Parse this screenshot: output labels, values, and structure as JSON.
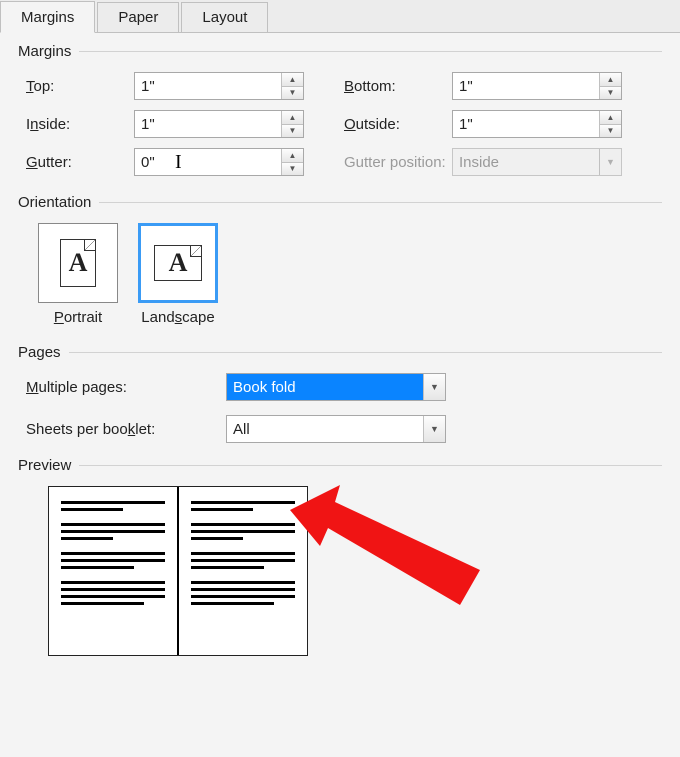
{
  "tabs": {
    "margins": "Margins",
    "paper": "Paper",
    "layout": "Layout"
  },
  "sections": {
    "margins": "Margins",
    "orientation": "Orientation",
    "pages": "Pages",
    "preview": "Preview"
  },
  "margins": {
    "top": {
      "label": "Top:",
      "value": "1\""
    },
    "bottom": {
      "label": "Bottom:",
      "value": "1\""
    },
    "inside": {
      "label": "Inside:",
      "value": "1\""
    },
    "outside": {
      "label": "Outside:",
      "value": "1\""
    },
    "gutter": {
      "label": "Gutter:",
      "value": "0\""
    },
    "gutter_pos": {
      "label": "Gutter position:",
      "value": "Inside"
    }
  },
  "orientation": {
    "portrait": {
      "label": "Portrait",
      "glyph": "A"
    },
    "landscape": {
      "label": "Landscape",
      "glyph": "A"
    }
  },
  "pages": {
    "multiple": {
      "label": "Multiple pages:",
      "value": "Book fold"
    },
    "sheets": {
      "label": "Sheets per booklet:",
      "value": "All"
    }
  }
}
